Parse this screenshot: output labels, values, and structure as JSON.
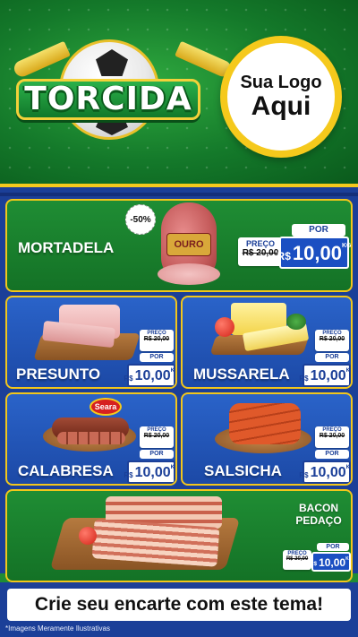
{
  "header": {
    "title": "TORCIDA",
    "logo_line1": "Sua Logo",
    "logo_line2": "Aqui"
  },
  "products": {
    "mortadela": {
      "name": "MORTADELA",
      "discount_badge": "-50%",
      "brand_label": "OURO",
      "old_label": "PREÇO",
      "old_price": "R$ 20,00",
      "new_label": "POR",
      "currency": "R$",
      "price": "10,00",
      "unit": "KG"
    },
    "presunto": {
      "name": "PRESUNTO",
      "old_label": "PREÇO",
      "old_price": "R$ 20,00",
      "new_label": "POR",
      "currency": "R$",
      "price": "10,00",
      "unit": "KG"
    },
    "mussarela": {
      "name": "MUSSARELA",
      "old_label": "PREÇO",
      "old_price": "R$ 20,00",
      "new_label": "POR",
      "currency": "R$",
      "price": "10,00",
      "unit": "KG"
    },
    "calabresa": {
      "name": "CALABRESA",
      "brand_label": "Seara",
      "old_label": "PREÇO",
      "old_price": "R$ 20,00",
      "new_label": "POR",
      "currency": "R$",
      "price": "10,00",
      "unit": "KG"
    },
    "salsicha": {
      "name": "SALSICHA",
      "old_label": "PREÇO",
      "old_price": "R$ 20,00",
      "new_label": "POR",
      "currency": "R$",
      "price": "10,00",
      "unit": "KG"
    },
    "bacon": {
      "name_line1": "BACON",
      "name_line2": "PEDAÇO",
      "old_label": "PREÇO",
      "old_price": "R$ 20,00",
      "new_label": "POR",
      "currency": "R$",
      "price": "10,00",
      "unit": "KG"
    }
  },
  "footer": {
    "cta": "Crie seu encarte com este tema!",
    "disclaimer": "*Imagens Meramente Ilustrativas"
  },
  "colors": {
    "green": "#1f8d34",
    "blue": "#1b3f98",
    "gold": "#f5c91c"
  }
}
